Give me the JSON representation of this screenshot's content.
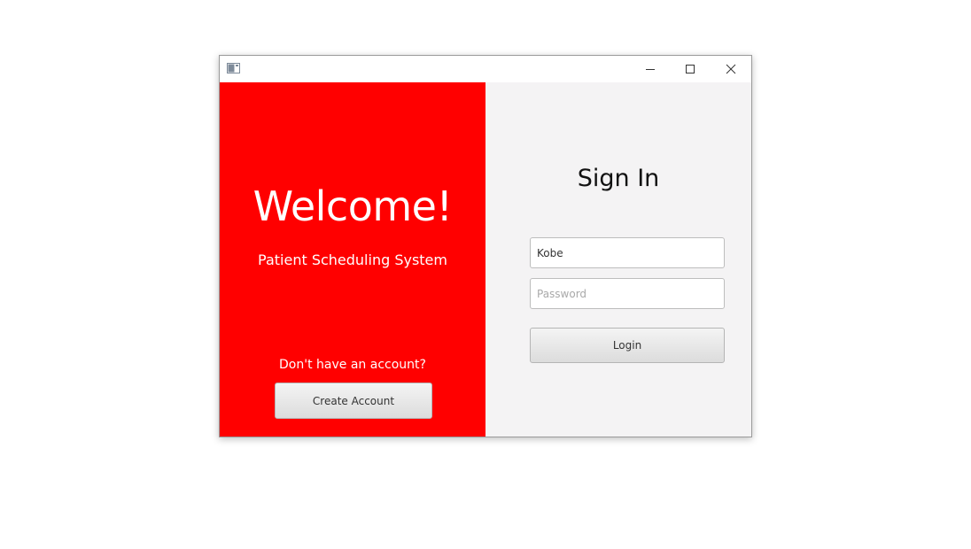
{
  "window": {
    "controls": {
      "minimize_icon": "minimize-icon",
      "maximize_icon": "maximize-icon",
      "close_icon": "close-icon"
    }
  },
  "left_panel": {
    "background_color": "#ff0000",
    "welcome_text": "Welcome!",
    "subtitle": "Patient Scheduling System",
    "no_account_text": "Don't have an account?",
    "create_account_label": "Create Account"
  },
  "right_panel": {
    "background_color": "#f4f3f4",
    "title": "Sign In",
    "username_value": "Kobe",
    "password_placeholder": "Password",
    "login_label": "Login"
  }
}
